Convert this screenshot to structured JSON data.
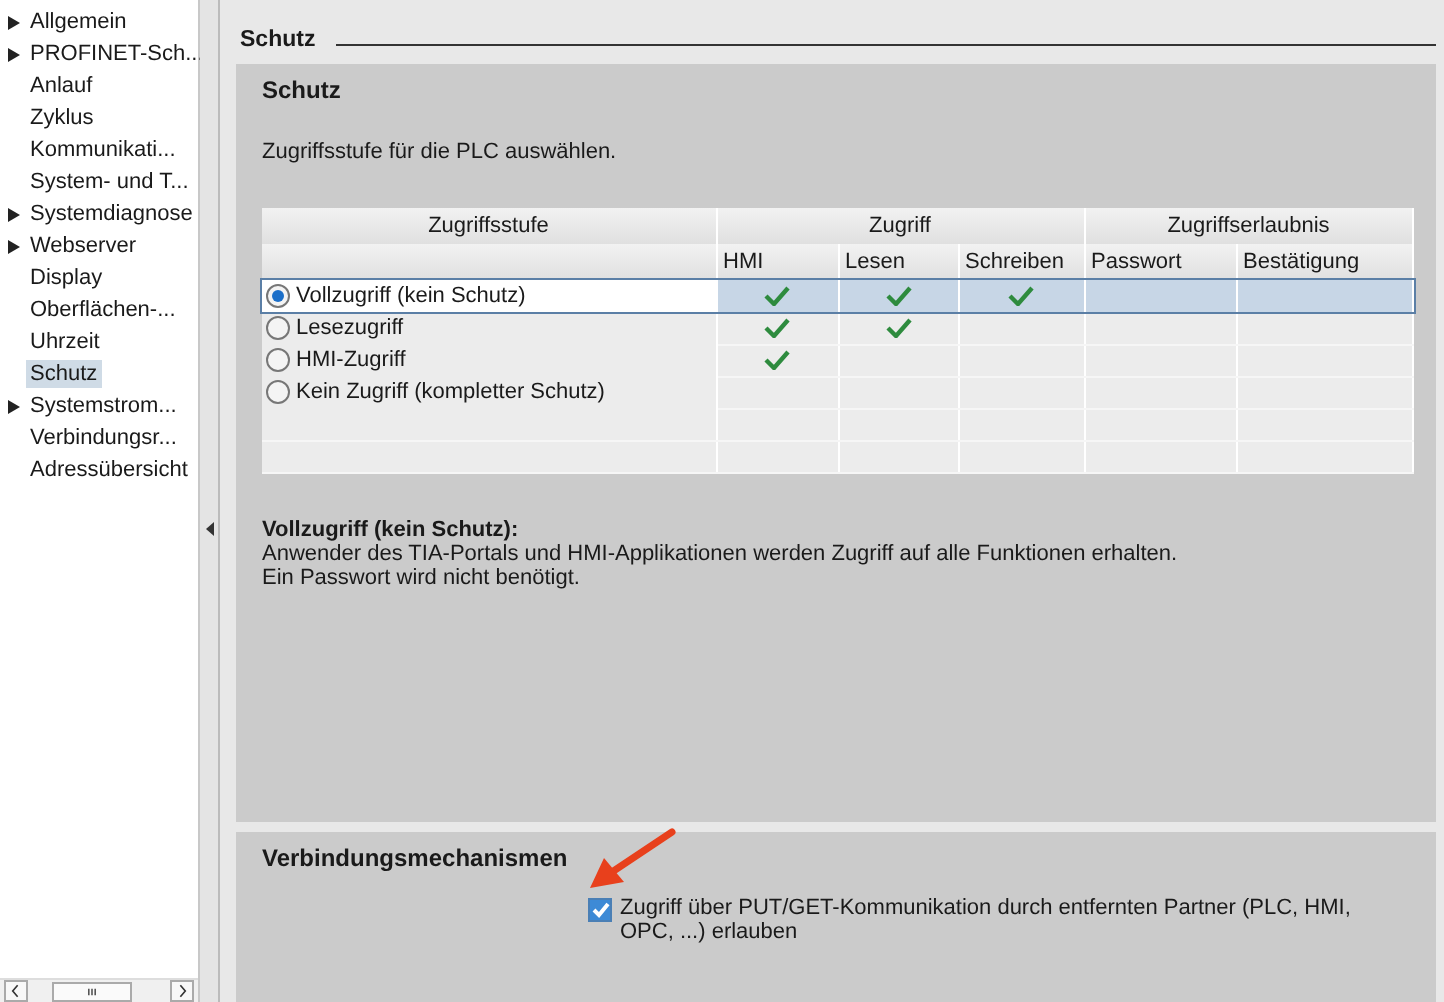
{
  "sidebar": {
    "items": [
      {
        "label": "Allgemein",
        "expandable": true,
        "selected": false
      },
      {
        "label": "PROFINET-Sch...",
        "expandable": true,
        "selected": false
      },
      {
        "label": "Anlauf",
        "expandable": false,
        "selected": false
      },
      {
        "label": "Zyklus",
        "expandable": false,
        "selected": false
      },
      {
        "label": "Kommunikati...",
        "expandable": false,
        "selected": false
      },
      {
        "label": "System- und T...",
        "expandable": false,
        "selected": false
      },
      {
        "label": "Systemdiagnose",
        "expandable": true,
        "selected": false
      },
      {
        "label": "Webserver",
        "expandable": true,
        "selected": false
      },
      {
        "label": "Display",
        "expandable": false,
        "selected": false
      },
      {
        "label": "Oberflächen-...",
        "expandable": false,
        "selected": false
      },
      {
        "label": "Uhrzeit",
        "expandable": false,
        "selected": false
      },
      {
        "label": "Schutz",
        "expandable": false,
        "selected": true
      },
      {
        "label": "Systemstrom...",
        "expandable": true,
        "selected": false
      },
      {
        "label": "Verbindungsr...",
        "expandable": false,
        "selected": false
      },
      {
        "label": "Adressübersicht",
        "expandable": false,
        "selected": false
      }
    ]
  },
  "section_title": "Schutz",
  "protection_panel": {
    "title": "Schutz",
    "instruction": "Zugriffsstufe für die PLC auswählen.",
    "table": {
      "group_headers": [
        "Zugriffsstufe",
        "Zugriff",
        "Zugriffserlaubnis"
      ],
      "columns": [
        "HMI",
        "Lesen",
        "Schreiben",
        "Passwort",
        "Bestätigung"
      ],
      "rows": [
        {
          "label": "Vollzugriff (kein Schutz)",
          "selected": true,
          "hmi": true,
          "read": true,
          "write": true
        },
        {
          "label": "Lesezugriff",
          "selected": false,
          "hmi": true,
          "read": true,
          "write": false
        },
        {
          "label": "HMI-Zugriff",
          "selected": false,
          "hmi": true,
          "read": false,
          "write": false
        },
        {
          "label": "Kein Zugriff (kompletter Schutz)",
          "selected": false,
          "hmi": false,
          "read": false,
          "write": false
        }
      ]
    },
    "description_title": "Vollzugriff (kein Schutz):",
    "description_lines": [
      "Anwender des TIA-Portals und HMI-Applikationen werden Zugriff auf alle Funktionen erhalten.",
      "Ein Passwort wird nicht benötigt."
    ]
  },
  "connection_panel": {
    "title": "Verbindungsmechanismen",
    "option": {
      "label": "Zugriff über PUT/GET-Kommunikation durch entfernten Partner (PLC, HMI, OPC, ...) erlauben",
      "checked": true
    }
  }
}
